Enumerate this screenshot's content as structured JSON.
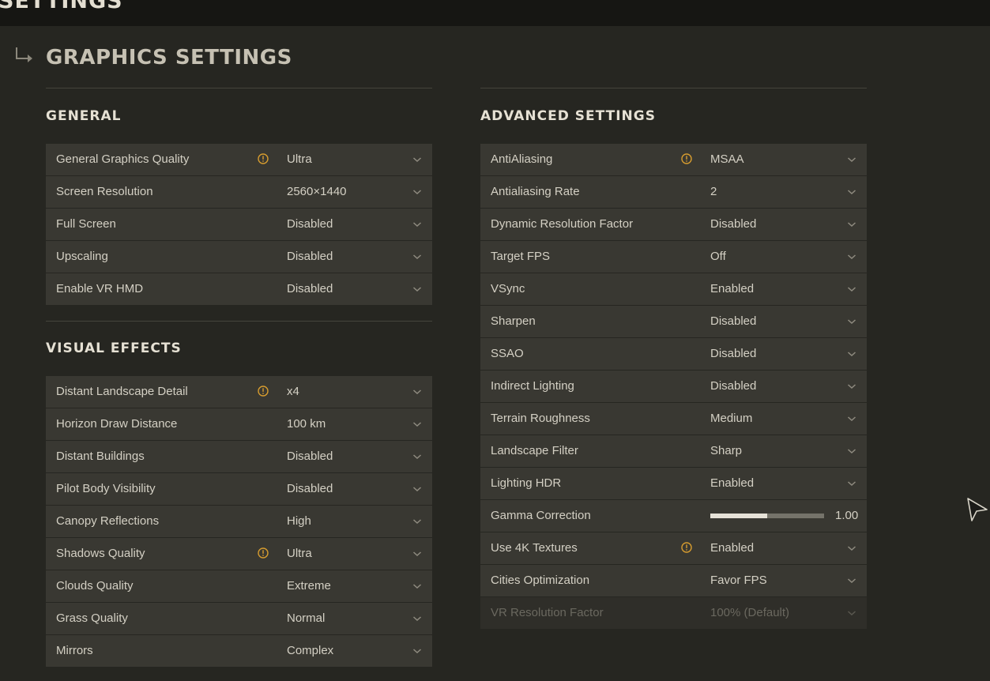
{
  "header": {
    "title": "SETTINGS"
  },
  "page": {
    "title": "GRAPHICS SETTINGS"
  },
  "icons": {
    "warning": "warning-icon",
    "dropdown": "chevron-down-icon",
    "back": "return-arrow-icon",
    "cursor": "pointer-cursor-icon"
  },
  "colors": {
    "warning": "#d69c2f",
    "background": "#262621",
    "row": "#393832"
  },
  "general": {
    "title": "GENERAL",
    "rows": [
      {
        "label": "General Graphics Quality",
        "value": "Ultra",
        "warning": true
      },
      {
        "label": "Screen Resolution",
        "value": "2560×1440"
      },
      {
        "label": "Full Screen",
        "value": "Disabled"
      },
      {
        "label": "Upscaling",
        "value": "Disabled"
      },
      {
        "label": "Enable VR HMD",
        "value": "Disabled"
      }
    ]
  },
  "visual": {
    "title": "VISUAL EFFECTS",
    "rows": [
      {
        "label": "Distant Landscape Detail",
        "value": "x4",
        "warning": true
      },
      {
        "label": "Horizon Draw Distance",
        "value": "100 km"
      },
      {
        "label": "Distant Buildings",
        "value": "Disabled"
      },
      {
        "label": "Pilot Body Visibility",
        "value": "Disabled"
      },
      {
        "label": "Canopy Reflections",
        "value": "High"
      },
      {
        "label": "Shadows Quality",
        "value": "Ultra",
        "warning": true
      },
      {
        "label": "Clouds Quality",
        "value": "Extreme"
      },
      {
        "label": "Grass Quality",
        "value": "Normal"
      },
      {
        "label": "Mirrors",
        "value": "Complex"
      }
    ]
  },
  "advanced": {
    "title": "ADVANCED SETTINGS",
    "rows": [
      {
        "label": "AntiAliasing",
        "value": "MSAA",
        "warning": true
      },
      {
        "label": "Antialiasing Rate",
        "value": "2"
      },
      {
        "label": "Dynamic Resolution Factor",
        "value": "Disabled"
      },
      {
        "label": "Target FPS",
        "value": "Off"
      },
      {
        "label": "VSync",
        "value": "Enabled"
      },
      {
        "label": "Sharpen",
        "value": "Disabled"
      },
      {
        "label": "SSAO",
        "value": "Disabled"
      },
      {
        "label": "Indirect Lighting",
        "value": "Disabled"
      },
      {
        "label": "Terrain Roughness",
        "value": "Medium"
      },
      {
        "label": "Landscape Filter",
        "value": "Sharp"
      },
      {
        "label": "Lighting HDR",
        "value": "Enabled"
      },
      {
        "label": "Gamma Correction",
        "value": "1.00",
        "slider": true,
        "slider_fraction": 0.5
      },
      {
        "label": "Use 4K Textures",
        "value": "Enabled",
        "warning": true
      },
      {
        "label": "Cities Optimization",
        "value": "Favor FPS"
      },
      {
        "label": "VR Resolution Factor",
        "value": "100% (Default)",
        "disabled": true
      }
    ]
  }
}
